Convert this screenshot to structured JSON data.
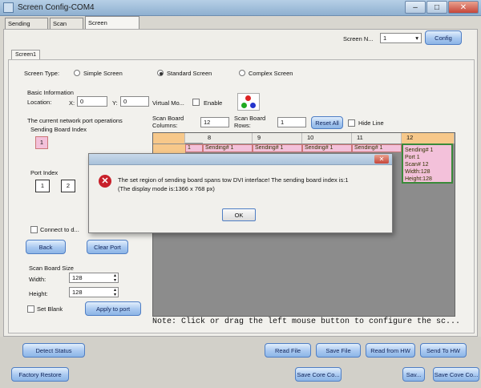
{
  "window": {
    "title": "Screen Config-COM4",
    "minimize": "–",
    "maximize": "□",
    "close": "✕"
  },
  "tabs": [
    "Sending Board",
    "Scan Board",
    "Screen Connection"
  ],
  "screen_selector": {
    "label": "Screen N...",
    "value": "1",
    "config_button": "Config"
  },
  "inner_tab": "Screen1",
  "screen_type": {
    "label": "Screen Type:",
    "options": [
      "Simple Screen",
      "Standard Screen",
      "Complex Screen"
    ],
    "selected": "Standard Screen"
  },
  "basic_info": {
    "heading": "Basic Information",
    "location_label": "Location:",
    "x_label": "X:",
    "x_value": "0",
    "y_label": "Y:",
    "y_value": "0",
    "virtual_label": "Virtual Mo...",
    "enable_label": "Enable"
  },
  "network": {
    "heading": "The current network port operations",
    "sending_board_index_label": "Sending Board Index",
    "sending_board_index_value": "1",
    "port_index_label": "Port Index",
    "port_values": [
      "1",
      "2"
    ],
    "connect_label": "Connect to d...",
    "back_button": "Back",
    "clear_port_button": "Clear Port"
  },
  "scan_board_size": {
    "heading": "Scan Board Size",
    "width_label": "Width:",
    "width_value": "128",
    "height_label": "Height:",
    "height_value": "128",
    "set_blank_label": "Set Blank",
    "apply_button": "Apply to port"
  },
  "grid_controls": {
    "columns_label": "Scan Board Columns:",
    "columns_value": "12",
    "rows_label": "Scan Board Rows:",
    "rows_value": "1",
    "reset_all_button": "Reset All",
    "hide_line_label": "Hide Line"
  },
  "grid": {
    "column_headers": [
      "8",
      "9",
      "10",
      "11",
      "12"
    ],
    "left_cell": "1",
    "cells": [
      "Sending# 1",
      "Sending# 1",
      "Sending# 1",
      "Sending# 1"
    ],
    "last_cell_lines": [
      "Sending# 1",
      "Port 1",
      "Scan# 12",
      "Width:128",
      "Height:128"
    ]
  },
  "note": "Note: Click or drag the left mouse button to configure the sc...",
  "dialog": {
    "title": "",
    "message_line1": "The set region of sending board spans tow DVI interface! The sending board index is:1",
    "message_line2": "(The display mode is:1366 x 768 px)",
    "ok_button": "OK",
    "close": "✕"
  },
  "bottom_buttons": {
    "detect_status": "Detect Status",
    "read_file": "Read File",
    "save_file": "Save File",
    "read_from_hw": "Read from HW",
    "send_to_hw": "Send To HW",
    "factory_restore": "Factory Restore",
    "save_core_co": "Save Core Co...",
    "save": "Sav...",
    "save_cove_co": "Save Cove Co..."
  },
  "colors": {
    "accent_blue": "#a8c8f0",
    "cell_pink": "#f3c1da",
    "selected_orange": "#f7c88a",
    "error_red": "#c8202a"
  }
}
